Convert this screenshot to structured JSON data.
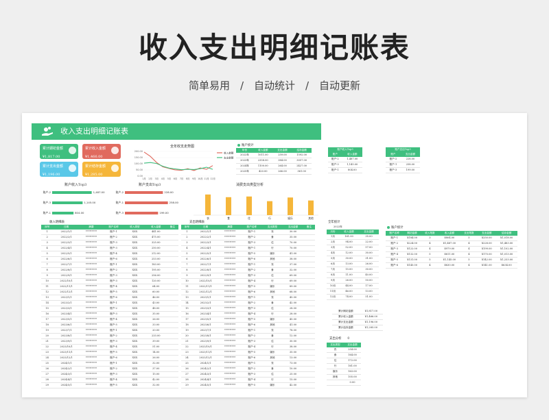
{
  "hero": {
    "title": "收入支出明细记账表",
    "subtitle": "简单易用　/　自动统计　/　自动更新"
  },
  "sheet": {
    "title": "收入支出明细记账表"
  },
  "colors": {
    "accent": "#3fbf7f",
    "green": "#3fbf7f",
    "red": "#e06a5e",
    "blue": "#5ac8e8",
    "orange": "#f5b63a"
  },
  "cards": [
    {
      "label": "累计期初金额",
      "value": "¥1,817.00",
      "color": "#3fbf7f",
      "icon": "money-icon"
    },
    {
      "label": "累计收入金额",
      "value": "¥1,466.00",
      "color": "#e06a5e",
      "icon": "income-icon"
    },
    {
      "label": "累计支出金额",
      "value": "¥1,196.00",
      "color": "#5ac8e8",
      "icon": "expense-icon"
    },
    {
      "label": "累计结存金额",
      "value": "¥1,285.00",
      "color": "#f5b63a",
      "icon": "balance-icon"
    }
  ],
  "stats": {
    "title": "账户统计",
    "headers": [
      "年份",
      "收入金额",
      "支出金额",
      "结存金额"
    ],
    "rows": [
      [
        "2022年",
        "1011.00",
        "259.00",
        "1592.00"
      ],
      [
        "2023年",
        "2358.00",
        "384.00",
        "3057.00"
      ],
      [
        "2024年",
        "1100.00",
        "264.00",
        "2427.00"
      ],
      [
        "2025年",
        "420.00",
        "266.00",
        "361.00"
      ]
    ]
  },
  "acc_in": {
    "title": "账户收入Top3",
    "headers": [
      "账户",
      "收入金额"
    ],
    "rows": [
      [
        "账户-2",
        "1,487.00"
      ],
      [
        "账户-3",
        "1,145.00"
      ],
      [
        "账户-1",
        "804.00"
      ]
    ]
  },
  "acc_out": {
    "title": "账户支出Top3",
    "headers": [
      "账户",
      "支出金额"
    ],
    "rows": [
      [
        "账户-2",
        "228.00"
      ],
      [
        "账户-1",
        "258.00"
      ],
      [
        "账户-3",
        "199.00"
      ]
    ]
  },
  "chart_data": [
    {
      "type": "line",
      "title": "全年收支走势图",
      "categories": [
        "1月",
        "2月",
        "3月",
        "4月",
        "5月",
        "6月",
        "7月",
        "8月",
        "9月",
        "10月",
        "11月",
        "12月"
      ],
      "series": [
        {
          "name": "收入金额",
          "color": "#e06a5e",
          "values": [
            195,
            160,
            110,
            75,
            62,
            50,
            47,
            60,
            45,
            66,
            55,
            85
          ]
        },
        {
          "name": "支出金额",
          "color": "#3fbf7f",
          "values": [
            105,
            110,
            102,
            80,
            65,
            58,
            52,
            55,
            53,
            60,
            72,
            55
          ]
        }
      ],
      "ylim": [
        0,
        200
      ],
      "yticks": [
        "0.00",
        "50.00",
        "100.00",
        "150.00",
        "200.00"
      ]
    },
    {
      "type": "bar",
      "orientation": "horizontal",
      "title": "账户收入Top3",
      "categories": [
        "账户-2",
        "账户-3",
        "账户-1"
      ],
      "values": [
        1487,
        1145,
        804
      ],
      "labels": [
        "1,487.00",
        "1,145.00",
        "804.00"
      ],
      "color": "#3fbf7f",
      "xlim": [
        0,
        1600
      ]
    },
    {
      "type": "bar",
      "orientation": "horizontal",
      "title": "账户支出Top3",
      "categories": [
        "账户-2",
        "账户-1",
        "账户-3"
      ],
      "values": [
        228,
        258,
        199
      ],
      "labels": [
        "228.00",
        "258.00",
        "199.00"
      ],
      "color": "#e06a5e",
      "xlim": [
        0,
        280
      ]
    },
    {
      "type": "bar",
      "title": "消费支出类型分析",
      "categories": [
        "衣",
        "食",
        "住",
        "行",
        "娱乐",
        "其他"
      ],
      "values": [
        310,
        270,
        280,
        210,
        265,
        220
      ],
      "color": "#f5b63a",
      "ylim": [
        0,
        350
      ]
    }
  ],
  "income": {
    "title": "收入明细表",
    "headers": [
      "序号",
      "日期",
      "摘要",
      "账户名称",
      "收入类型",
      "收入金额",
      "备注"
    ],
    "rows": [
      [
        "1",
        "2022/1/1",
        "*********",
        "账户-1",
        "XXX",
        "441.00",
        ""
      ],
      [
        "2",
        "2022/2/1",
        "*********",
        "账户-2",
        "XXX",
        "475.00",
        ""
      ],
      [
        "3",
        "2022/3/1",
        "*********",
        "账户-3",
        "XXX",
        "325.00",
        ""
      ],
      [
        "4",
        "2022/4/1",
        "*********",
        "账户-3",
        "XXX",
        "250.00",
        ""
      ],
      [
        "5",
        "2022/5/1",
        "*********",
        "账户-4",
        "XXX",
        "212.00",
        ""
      ],
      [
        "6",
        "2022/6/1",
        "*********",
        "账户-6",
        "XXX",
        "253.00",
        ""
      ],
      [
        "7",
        "2022/7/1",
        "*********",
        "账户-1",
        "XXX",
        "183.00",
        ""
      ],
      [
        "8",
        "2022/8/1",
        "*********",
        "账户-2",
        "XXX",
        "195.00",
        ""
      ],
      [
        "9",
        "2022/9/1",
        "*********",
        "账户-3",
        "XXX",
        "256.00",
        ""
      ],
      [
        "10",
        "2022/10/1",
        "*********",
        "账户-3",
        "XXX",
        "120.00",
        ""
      ],
      [
        "11",
        "2022/11/1",
        "*********",
        "账户-4",
        "XXX",
        "64.00",
        ""
      ],
      [
        "12",
        "2022/12/1",
        "*********",
        "账户-5",
        "XXX",
        "60.00",
        ""
      ],
      [
        "13",
        "2023/1/1",
        "*********",
        "账户-6",
        "XXX",
        "46.00",
        ""
      ],
      [
        "14",
        "2023/2/1",
        "*********",
        "账户-1",
        "XXX",
        "43.00",
        ""
      ],
      [
        "15",
        "2023/3/1",
        "*********",
        "账户-2",
        "XXX",
        "48.00",
        ""
      ],
      [
        "16",
        "2023/4/1",
        "*********",
        "账户-3",
        "XXX",
        "35.00",
        ""
      ],
      [
        "17",
        "2023/5/1",
        "*********",
        "账户-4",
        "XXX",
        "26.00",
        ""
      ],
      [
        "18",
        "2023/6/1",
        "*********",
        "账户-5",
        "XXX",
        "33.00",
        ""
      ],
      [
        "19",
        "2023/7/1",
        "*********",
        "账户-1",
        "XXX",
        "20.00",
        ""
      ],
      [
        "20",
        "2023/8/1",
        "*********",
        "账户-2",
        "XXX",
        "233.00",
        ""
      ],
      [
        "21",
        "2023/9/1",
        "*********",
        "账户-3",
        "XXX",
        "39.00",
        ""
      ],
      [
        "22",
        "2023/10/1",
        "*********",
        "账户-4",
        "XXX",
        "51.00",
        ""
      ],
      [
        "23",
        "2023/11/1",
        "*********",
        "账户-5",
        "XXX",
        "14.00",
        ""
      ],
      [
        "24",
        "2023/12/1",
        "*********",
        "账户-6",
        "XXX",
        "26.00",
        ""
      ],
      [
        "25",
        "2024/1/1",
        "*********",
        "账户-1",
        "XXX",
        "32.00",
        ""
      ],
      [
        "26",
        "2024/2/1",
        "*********",
        "账户-2",
        "XXX",
        "37.00",
        ""
      ],
      [
        "27",
        "2024/3/1",
        "*********",
        "账户-3",
        "XXX",
        "15.00",
        ""
      ],
      [
        "28",
        "2024/4/1",
        "*********",
        "账户-4",
        "XXX",
        "42.00",
        ""
      ],
      [
        "29",
        "2024/5/1",
        "*********",
        "账户-5",
        "XXX",
        "32.00",
        ""
      ]
    ]
  },
  "expense": {
    "title": "支出明细表",
    "headers": [
      "序号",
      "日期",
      "摘要",
      "账户名称",
      "支出类型",
      "支出金额",
      "备注"
    ],
    "rows": [
      [
        "1",
        "2022/1/1",
        "*********",
        "账户-1",
        "衣",
        "30.00",
        ""
      ],
      [
        "2",
        "2022/2/1",
        "*********",
        "账户-2",
        "食",
        "35.00",
        ""
      ],
      [
        "3",
        "2022/3/1",
        "*********",
        "账户-3",
        "住",
        "70.00",
        ""
      ],
      [
        "4",
        "2022/4/1",
        "*********",
        "账户-1",
        "行",
        "70.00",
        ""
      ],
      [
        "5",
        "2022/5/1",
        "*********",
        "账户-5",
        "娱乐",
        "41.00",
        ""
      ],
      [
        "6",
        "2022/6/1",
        "*********",
        "账户-6",
        "其他",
        "38.00",
        ""
      ],
      [
        "7",
        "2022/7/1",
        "*********",
        "账户-1",
        "衣",
        "37.00",
        ""
      ],
      [
        "8",
        "2022/8/1",
        "*********",
        "账户-2",
        "食",
        "32.00",
        ""
      ],
      [
        "9",
        "2022/9/1",
        "*********",
        "账户-3",
        "住",
        "69.00",
        ""
      ],
      [
        "10",
        "2022/10/1",
        "*********",
        "账户-4",
        "行",
        "69.00",
        ""
      ],
      [
        "11",
        "2022/11/1",
        "*********",
        "账户-5",
        "娱乐",
        "89.00",
        ""
      ],
      [
        "12",
        "2022/12/1",
        "*********",
        "账户-6",
        "其他",
        "68.00",
        ""
      ],
      [
        "13",
        "2023/1/1",
        "*********",
        "账户-1",
        "衣",
        "45.00",
        ""
      ],
      [
        "14",
        "2023/2/1",
        "*********",
        "账户-2",
        "食",
        "42.00",
        ""
      ],
      [
        "15",
        "2023/3/1",
        "*********",
        "账户-3",
        "住",
        "28.00",
        ""
      ],
      [
        "16",
        "2023/4/1",
        "*********",
        "账户-4",
        "行",
        "28.00",
        ""
      ],
      [
        "17",
        "2023/5/1",
        "*********",
        "账户-5",
        "娱乐",
        "45.00",
        ""
      ],
      [
        "18",
        "2023/6/1",
        "*********",
        "账户-6",
        "其他",
        "41.00",
        ""
      ],
      [
        "19",
        "2023/7/1",
        "*********",
        "账户-1",
        "衣",
        "78.00",
        ""
      ],
      [
        "20",
        "2023/8/1",
        "*********",
        "账户-2",
        "食",
        "12.00",
        ""
      ],
      [
        "21",
        "2023/9/1",
        "*********",
        "账户-3",
        "住",
        "30.00",
        ""
      ],
      [
        "22",
        "2023/10/1",
        "*********",
        "账户-4",
        "行",
        "38.00",
        ""
      ],
      [
        "23",
        "2023/11/1",
        "*********",
        "账户-5",
        "娱乐",
        "35.00",
        ""
      ],
      [
        "24",
        "2023/12/1",
        "*********",
        "账户-6",
        "其他",
        "13.00",
        ""
      ],
      [
        "25",
        "2024/1/1",
        "*********",
        "账户-1",
        "衣",
        "73.00",
        ""
      ],
      [
        "26",
        "2024/2/1",
        "*********",
        "账户-2",
        "食",
        "10.00",
        ""
      ],
      [
        "27",
        "2024/3/1",
        "*********",
        "账户-3",
        "住",
        "25.00",
        ""
      ],
      [
        "28",
        "2024/4/1",
        "*********",
        "账户-4",
        "行",
        "15.00",
        ""
      ],
      [
        "29",
        "2024/5/1",
        "*********",
        "账户-5",
        "娱乐",
        "42.00",
        ""
      ]
    ]
  },
  "yearly": {
    "title": "全年统计",
    "year": "2022年",
    "headers": [
      "月份",
      "收入金额",
      "支出金额"
    ],
    "rows": [
      [
        "1月",
        "161.00",
        "35.00"
      ],
      [
        "2月",
        "94.00",
        "22.00"
      ],
      [
        "3月",
        "52.00",
        "57.00"
      ],
      [
        "4月",
        "12.00",
        "30.00"
      ],
      [
        "5月",
        "30.00",
        "31.00"
      ],
      [
        "6月",
        "13.00",
        "26.00"
      ],
      [
        "7月",
        "15.00",
        "30.00"
      ],
      [
        "8月",
        "11.00",
        "40.00"
      ],
      [
        "9月",
        "26.00",
        "50.00"
      ],
      [
        "10月",
        "44.00",
        "17.00"
      ],
      [
        "11月",
        "46.00",
        "13.00"
      ],
      [
        "12月",
        "74.00",
        "51.00"
      ]
    ]
  },
  "totals": [
    [
      "累计期初金额",
      "¥1,817.00"
    ],
    [
      "累计收入金额",
      "¥1,466.00"
    ],
    [
      "累计支出金额",
      "¥1,196.00"
    ],
    [
      "累计结存金额",
      "¥1,285.00"
    ]
  ],
  "acct_stats": {
    "title": "账户统计",
    "headers": [
      "账户名称",
      "期初金额",
      "收入笔数",
      "收入金额",
      "支出笔数",
      "支出金额",
      "结存金额"
    ],
    "rows": [
      [
        "账户-1",
        "¥184.00",
        "3",
        "¥804.00",
        "5",
        "¥250.00",
        "¥1,018.00"
      ],
      [
        "账户-2",
        "¥224.00",
        "4",
        "¥1,487.00",
        "4",
        "¥228.00",
        "¥1,483.00"
      ],
      [
        "账户-3",
        "¥122.00",
        "4",
        "¥979.00",
        "4",
        "¥199.00",
        "¥1,102.00"
      ],
      [
        "账户-4",
        "¥132.00",
        "5",
        "¥611.00",
        "4",
        "¥170.00",
        "¥1,013.00"
      ],
      [
        "账户-5",
        "¥131.00",
        "5",
        "¥1,145.00",
        "5",
        "¥142.00",
        "¥1,233.00"
      ],
      [
        "账户-6",
        "¥145.00",
        "4",
        "¥630.00",
        "4",
        "¥141.00",
        "¥634.00"
      ]
    ]
  },
  "cost": {
    "title": "支出分析",
    "count": "0",
    "headers": [
      "支出类型",
      "支出金额"
    ],
    "rows": [
      [
        "衣",
        "254.00"
      ],
      [
        "食",
        "164.00"
      ],
      [
        "住",
        "172.00"
      ],
      [
        "行",
        "161.00"
      ],
      [
        "娱乐",
        "163.00"
      ],
      [
        "其他",
        "105.00"
      ],
      [
        "",
        "0.00"
      ]
    ]
  }
}
